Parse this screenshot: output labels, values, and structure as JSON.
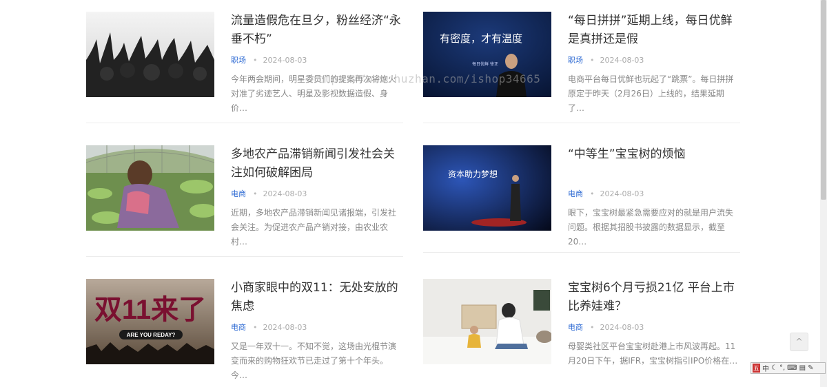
{
  "watermark": "https://www.huzhan.com/ishop34665",
  "articles": [
    {
      "title": "流量造假危在旦夕，粉丝经济“永垂不朽”",
      "category": "职场",
      "date": "2024-08-03",
      "excerpt": "今年两会期间，明星委员们的提案再次将炮火对准了劣迹艺人、明星及影视数据造假、身价…"
    },
    {
      "title": "“每日拼拼”延期上线，每日优鲜是真拼还是假",
      "category": "职场",
      "date": "2024-08-03",
      "excerpt": "电商平台每日优鲜也玩起了“跳票”。每日拼拼原定于昨天（2月26日）上线的，结果延期了…",
      "image_text": "有密度，才有温度",
      "image_sub": "每日优鲜 徐正"
    },
    {
      "title": "多地农产品滞销新闻引发社会关注如何破解困局",
      "category": "电商",
      "date": "2024-08-03",
      "excerpt": "近期，多地农产品滞销新闻见诸报端，引发社会关注。为促进农产品产销对接，由农业农村…"
    },
    {
      "title": "“中等生”宝宝树的烦恼",
      "category": "电商",
      "date": "2024-08-03",
      "excerpt": "眼下，宝宝树最紧急需要应对的就是用户流失问题。根据其招股书披露的数据显示，截至20…",
      "image_text": "资本助力梦想"
    },
    {
      "title": "小商家眼中的双11：无处安放的焦虑",
      "category": "电商",
      "date": "2024-08-03",
      "excerpt": "又是一年双十一。不知不觉，这场由光棍节演变而来的购物狂欢节已走过了第十个年头。今…",
      "image_text": "双11来了",
      "image_sub": "ARE YOU REDAY?"
    },
    {
      "title": "宝宝树6个月亏损21亿 平台上市比养娃难？",
      "category": "电商",
      "date": "2024-08-03",
      "excerpt": "母婴类社区平台宝宝树赴港上市风波再起。11月20日下午，据IFR，宝宝树指引IPO价格在…"
    }
  ],
  "ime": {
    "logo": "五",
    "mode": "中",
    "icons": [
      "moon-icon",
      "punctuation-icon",
      "keyboard-icon",
      "skin-icon",
      "tools-icon"
    ]
  },
  "back_to_top": "^"
}
